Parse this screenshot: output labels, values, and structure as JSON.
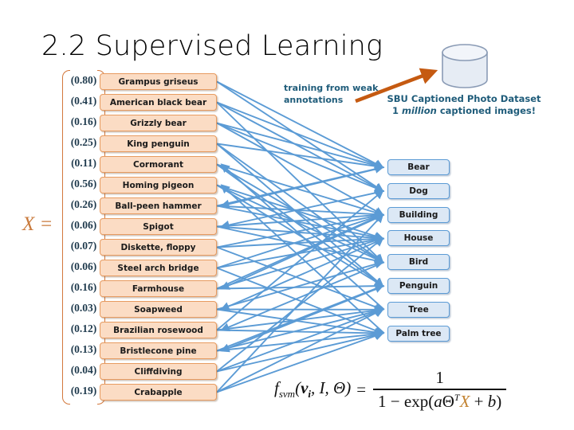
{
  "slide": {
    "title": "2.2 Supervised Learning",
    "x_equals_label": "X ="
  },
  "feature_vector": {
    "rows": [
      {
        "value": "(0.80)",
        "label": "Grampus griseus"
      },
      {
        "value": "(0.41)",
        "label": "American black bear"
      },
      {
        "value": "(0.16)",
        "label": "Grizzly bear"
      },
      {
        "value": "(0.25)",
        "label": "King penguin"
      },
      {
        "value": "(0.11)",
        "label": "Cormorant"
      },
      {
        "value": "(0.56)",
        "label": "Homing pigeon"
      },
      {
        "value": "(0.26)",
        "label": "Ball-peen hammer"
      },
      {
        "value": "(0.06)",
        "label": "Spigot"
      },
      {
        "value": "(0.07)",
        "label": "Diskette, floppy"
      },
      {
        "value": "(0.06)",
        "label": "Steel arch bridge"
      },
      {
        "value": "(0.16)",
        "label": "Farmhouse"
      },
      {
        "value": "(0.03)",
        "label": "Soapweed"
      },
      {
        "value": "(0.12)",
        "label": "Brazilian rosewood"
      },
      {
        "value": "(0.13)",
        "label": "Bristlecone pine"
      },
      {
        "value": "(0.04)",
        "label": "Cliffdiving"
      },
      {
        "value": "(0.19)",
        "label": "Crabapple"
      }
    ]
  },
  "classes": {
    "items": [
      {
        "label": "Bear"
      },
      {
        "label": "Dog"
      },
      {
        "label": "Building"
      },
      {
        "label": "House"
      },
      {
        "label": "Bird"
      },
      {
        "label": "Penguin"
      },
      {
        "label": "Tree"
      },
      {
        "label": "Palm tree"
      }
    ]
  },
  "annotations": {
    "training_note_line1": "training from weak",
    "training_note_line2": "annotations",
    "dataset_line1": "SBU Captioned Photo Dataset",
    "dataset_line2_pre": "1 ",
    "dataset_line2_italic": "million",
    "dataset_line2_post": " captioned images!"
  },
  "formula": {
    "function_name": "f",
    "function_sub": "svm",
    "args_open": "(",
    "arg_v": "v",
    "arg_v_sub": "i",
    "arg_sep1": ", ",
    "arg_I": "I",
    "arg_sep2": ", ",
    "arg_theta": "Θ",
    "args_close": ")",
    "equals": "=",
    "numerator": "1",
    "denominator_pre": "1 − exp(",
    "denominator_a": "a",
    "denominator_theta": "Θ",
    "denominator_sup": "T",
    "denominator_X": "X",
    "denominator_post": " + ",
    "denominator_b": "b",
    "denominator_close": ")"
  },
  "colors": {
    "feature_box_fill": "#FBDCC4",
    "feature_box_border": "#E79B60",
    "class_box_fill": "#DCE8F5",
    "class_box_border": "#5B9BD5",
    "edge_color": "#5B9BD5",
    "arrow_color": "#C55A11",
    "annotation_text": "#1F5C7A",
    "bracket_color": "#D3783C",
    "x_label_color": "#C97A3C"
  },
  "icons": {
    "database": "database-cylinder-icon",
    "arrow": "orange-arrow-icon"
  }
}
